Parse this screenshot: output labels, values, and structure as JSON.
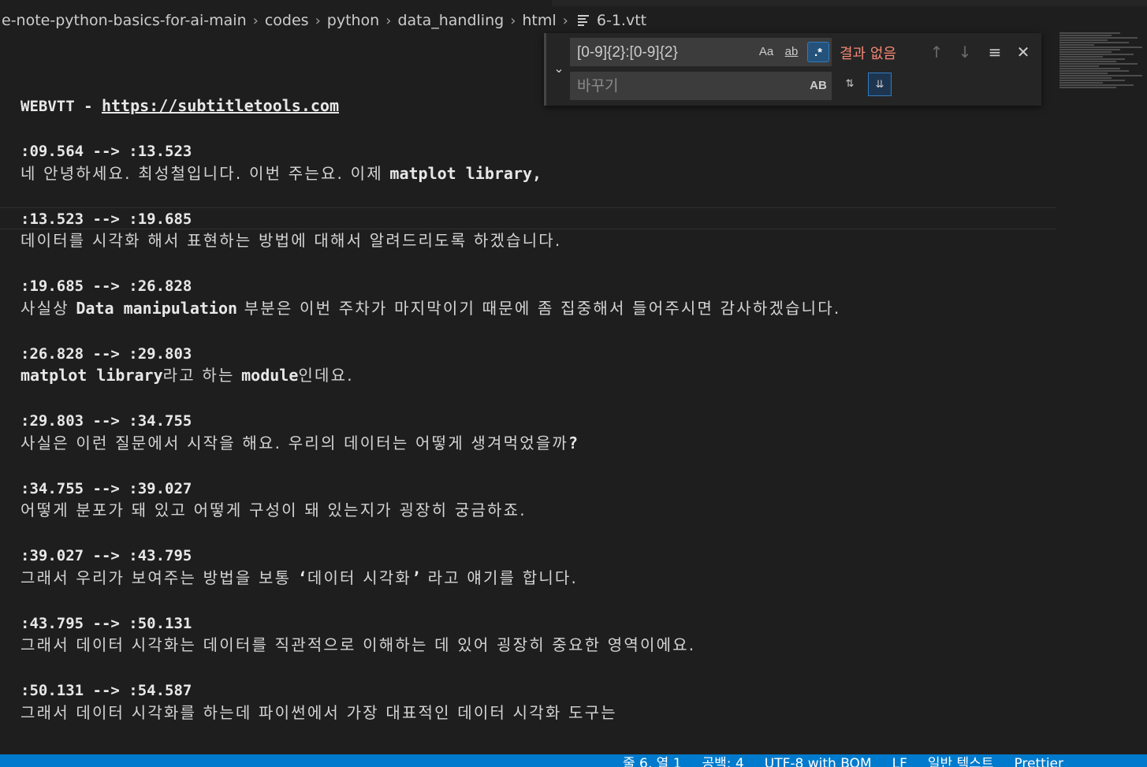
{
  "breadcrumb": [
    "e-note-python-basics-for-ai-main",
    "codes",
    "python",
    "data_handling",
    "html",
    "6-1.vtt"
  ],
  "find": {
    "search_value": "[0-9]{2}:[0-9]{2}",
    "match_case_label": "Aa",
    "whole_word_label": "ab",
    "regex_label": ".*",
    "no_results": "결과 없음",
    "replace_placeholder": "바꾸기",
    "preserve_case_label": "AB"
  },
  "editor": {
    "header_prefix": "WEBVTT - ",
    "header_link": "https://subtitletools.com",
    "cues": [
      {
        "time": ":09.564 --> :13.523",
        "text": [
          {
            "k": "kr",
            "t": "네 안녕하세요. 최성철입니다. 이번 주는요. 이제 "
          },
          {
            "k": "code",
            "t": "matplot library,"
          }
        ]
      },
      {
        "time": ":13.523 --> :19.685",
        "text": [
          {
            "k": "kr",
            "t": "데이터를 시각화 해서 표현하는 방법에 대해서 알려드리도록 하겠습니다."
          }
        ]
      },
      {
        "time": ":19.685 --> :26.828",
        "text": [
          {
            "k": "kr",
            "t": "사실상 "
          },
          {
            "k": "code",
            "t": "Data manipulation"
          },
          {
            "k": "kr",
            "t": " 부분은 이번 주차가 마지막이기 때문에 좀 집중해서 들어주시면 감사하겠습니다."
          }
        ]
      },
      {
        "time": ":26.828 --> :29.803",
        "text": [
          {
            "k": "code",
            "t": "matplot library"
          },
          {
            "k": "kr",
            "t": "라고 하는 "
          },
          {
            "k": "code",
            "t": "module"
          },
          {
            "k": "kr",
            "t": "인데요."
          }
        ]
      },
      {
        "time": ":29.803 --> :34.755",
        "text": [
          {
            "k": "kr",
            "t": "사실은 이런 질문에서 시작을 해요. 우리의 데이터는 어떻게 생겨먹었을까"
          },
          {
            "k": "code",
            "t": "?"
          }
        ]
      },
      {
        "time": ":34.755 --> :39.027",
        "text": [
          {
            "k": "kr",
            "t": "어떻게 분포가 돼 있고 어떻게 구성이 돼 있는지가 굉장히 궁금하죠."
          }
        ]
      },
      {
        "time": ":39.027 --> :43.795",
        "text": [
          {
            "k": "kr",
            "t": "그래서 우리가 보여주는 방법을 보통 "
          },
          {
            "k": "code",
            "t": "‘"
          },
          {
            "k": "kr",
            "t": "데이터 시각화"
          },
          {
            "k": "code",
            "t": "’"
          },
          {
            "k": "kr",
            "t": " 라고 얘기를 합니다."
          }
        ]
      },
      {
        "time": ":43.795 --> :50.131",
        "text": [
          {
            "k": "kr",
            "t": "그래서 데이터 시각화는 데이터를 직관적으로 이해하는 데 있어 굉장히 중요한 영역이에요."
          }
        ]
      },
      {
        "time": ":50.131 --> :54.587",
        "text": [
          {
            "k": "kr",
            "t": "그래서 데이터 시각화를 하는데 파이썬에서 가장 대표적인 데이터 시각화 도구는"
          }
        ]
      }
    ]
  },
  "statusbar": [
    "줄 6, 열 1",
    "공백: 4",
    "UTF-8 with BOM",
    "LF",
    "일반 텍스트",
    "Prettier"
  ],
  "colors": {
    "accent": "#007acc",
    "background": "#1e1e1e",
    "no_results": "#f48771"
  }
}
